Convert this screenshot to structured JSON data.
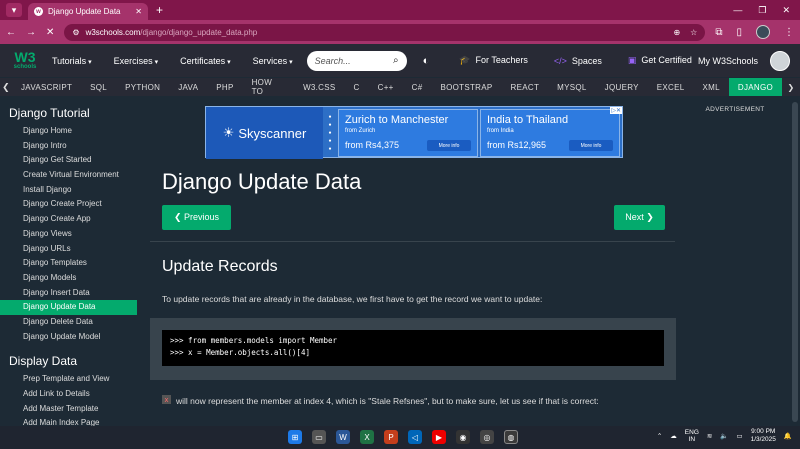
{
  "browser": {
    "tab_title": "Django Update Data",
    "url_host": "w3schools.com",
    "url_path": "/django/django_update_data.php",
    "accent": "#a5336b"
  },
  "topnav": {
    "logo_main": "W3",
    "logo_sub": "schools",
    "menu": [
      "Tutorials",
      "Exercises",
      "Certificates",
      "Services"
    ],
    "search_placeholder": "Search...",
    "for_teachers": "For Teachers",
    "spaces": "Spaces",
    "get_certified": "Get Certified",
    "my_w3schools": "My W3Schools"
  },
  "subnav": {
    "items": [
      "JAVASCRIPT",
      "SQL",
      "PYTHON",
      "JAVA",
      "PHP",
      "HOW TO",
      "W3.CSS",
      "C",
      "C++",
      "C#",
      "BOOTSTRAP",
      "REACT",
      "MYSQL",
      "JQUERY",
      "EXCEL",
      "XML",
      "DJANGO"
    ],
    "active_index": 16
  },
  "sidebar": {
    "heading1": "Django Tutorial",
    "items1": [
      "Django Home",
      "Django Intro",
      "Django Get Started",
      "Create Virtual Environment",
      "Install Django",
      "Django Create Project",
      "Django Create App",
      "Django Views",
      "Django URLs",
      "Django Templates",
      "Django Models",
      "Django Insert Data",
      "Django Update Data",
      "Django Delete Data",
      "Django Update Model"
    ],
    "active_item": "Django Update Data",
    "heading2": "Display Data",
    "items2": [
      "Prep Template and View",
      "Add Link to Details",
      "Add Master Template",
      "Add Main Index Page"
    ]
  },
  "ad": {
    "brand": "Skyscanner",
    "card1": {
      "title": "Zurich to Manchester",
      "from": "from Zurich",
      "price": "from Rs4,375",
      "btn": "More info"
    },
    "card2": {
      "title": "India to Thailand",
      "from": "from India",
      "price": "from Rs12,965",
      "btn": "More info"
    }
  },
  "main": {
    "title": "Django Update Data",
    "prev_label": "❮ Previous",
    "next_label": "Next ❯",
    "section_title": "Update Records",
    "intro": "To update records that are already in the database, we first have to get the record we want to update:",
    "code": ">>> from members.models import Member\n>>> x = Member.objects.all()[4]",
    "inline_code": "x",
    "para2": "will now represent the member at index 4, which is \"Stale Refsnes\", but to make sure, let us see if that is correct:"
  },
  "rightcol": {
    "advertisement": "ADVERTISEMENT"
  },
  "taskbar": {
    "lang1": "ENG",
    "lang2": "IN",
    "time": "9:00 PM",
    "date": "1/3/2025"
  }
}
